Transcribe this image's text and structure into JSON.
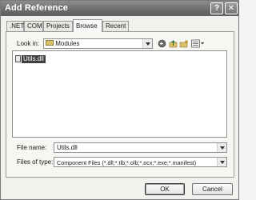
{
  "window": {
    "title": "Add Reference",
    "help_glyph": "?",
    "close_glyph": "✕"
  },
  "tabs": [
    {
      "label": ".NET"
    },
    {
      "label": "COM"
    },
    {
      "label": "Projects"
    },
    {
      "label": "Browse",
      "active": true
    },
    {
      "label": "Recent"
    }
  ],
  "browse": {
    "look_in_label": "Look in:",
    "look_in_value": "Modules",
    "toolbar_icons": [
      "back-icon",
      "up-folder-icon",
      "new-folder-icon",
      "views-menu-icon"
    ],
    "files": [
      {
        "name": "Utils.dll",
        "selected": true
      }
    ],
    "file_name_label": "File name:",
    "file_name_value": "Utils.dll",
    "files_of_type_label": "Files of type:",
    "files_of_type_value": "Component Files (*.dll;*.tlb;*.olb;*.ocx;*.exe;*.manifest)"
  },
  "buttons": {
    "ok": "OK",
    "cancel": "Cancel"
  },
  "colors": {
    "titlebar": "#6e6e6e",
    "selection": "#3f3f3f"
  }
}
